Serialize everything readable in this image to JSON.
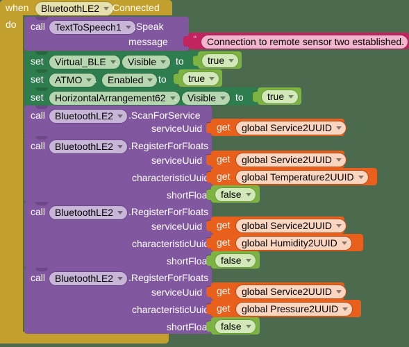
{
  "editor": {
    "name": "MIT App Inventor Blocks Editor",
    "background_color": "#4c6b4e"
  },
  "colors": {
    "event_block": "#c3a02e",
    "call_block": "#8157a0",
    "setter_block": "#2e7d4f",
    "logic_block": "#7cb342",
    "variable_get_block": "#e8601c",
    "text_block": "#c2245f"
  },
  "event": {
    "keyword_when": "when",
    "component": "BluetoothLE2",
    "event_name": ".Connected",
    "keyword_do": "do"
  },
  "blocks": [
    {
      "id": "tts-speak",
      "kind": "call",
      "keyword": "call",
      "component": "TextToSpeech1",
      "method": ".Speak",
      "args": [
        {
          "label": "message",
          "value_kind": "text",
          "value": "Connection to remote sensor two established."
        }
      ]
    },
    {
      "id": "set-virtual-ble-visible",
      "kind": "set",
      "keyword": "set",
      "component": "Virtual_BLE",
      "dot": ".",
      "property": "Visible",
      "keyword_to": "to",
      "value_kind": "logic",
      "value": "true"
    },
    {
      "id": "set-atmo-enabled",
      "kind": "set",
      "keyword": "set",
      "component": "ATMO",
      "dot": ".",
      "property": "Enabled",
      "keyword_to": "to",
      "value_kind": "logic",
      "value": "true"
    },
    {
      "id": "set-ha62-visible",
      "kind": "set",
      "keyword": "set",
      "component": "HorizontalArrangement62",
      "dot": ".",
      "property": "Visible",
      "keyword_to": "to",
      "value_kind": "logic",
      "value": "true"
    },
    {
      "id": "scan-for-service",
      "kind": "call",
      "keyword": "call",
      "component": "BluetoothLE2",
      "method": ".ScanForService",
      "args": [
        {
          "label": "serviceUuid",
          "value_kind": "get",
          "get_keyword": "get",
          "value": "global Service2UUID"
        }
      ]
    },
    {
      "id": "register-temperature",
      "kind": "call",
      "keyword": "call",
      "component": "BluetoothLE2",
      "method": ".RegisterForFloats",
      "args": [
        {
          "label": "serviceUuid",
          "value_kind": "get",
          "get_keyword": "get",
          "value": "global Service2UUID"
        },
        {
          "label": "characteristicUuid",
          "value_kind": "get",
          "get_keyword": "get",
          "value": "global Temperature2UUID"
        },
        {
          "label": "shortFloat",
          "value_kind": "logic",
          "value": "false"
        }
      ]
    },
    {
      "id": "register-humidity",
      "kind": "call",
      "keyword": "call",
      "component": "BluetoothLE2",
      "method": ".RegisterForFloats",
      "args": [
        {
          "label": "serviceUuid",
          "value_kind": "get",
          "get_keyword": "get",
          "value": "global Service2UUID"
        },
        {
          "label": "characteristicUuid",
          "value_kind": "get",
          "get_keyword": "get",
          "value": "global Humidity2UUID"
        },
        {
          "label": "shortFloat",
          "value_kind": "logic",
          "value": "false"
        }
      ]
    },
    {
      "id": "register-pressure",
      "kind": "call",
      "keyword": "call",
      "component": "BluetoothLE2",
      "method": ".RegisterForFloats",
      "args": [
        {
          "label": "serviceUuid",
          "value_kind": "get",
          "get_keyword": "get",
          "value": "global Service2UUID"
        },
        {
          "label": "characteristicUuid",
          "value_kind": "get",
          "get_keyword": "get",
          "value": "global Pressure2UUID"
        },
        {
          "label": "shortFloat",
          "value_kind": "logic",
          "value": "false"
        }
      ]
    }
  ]
}
